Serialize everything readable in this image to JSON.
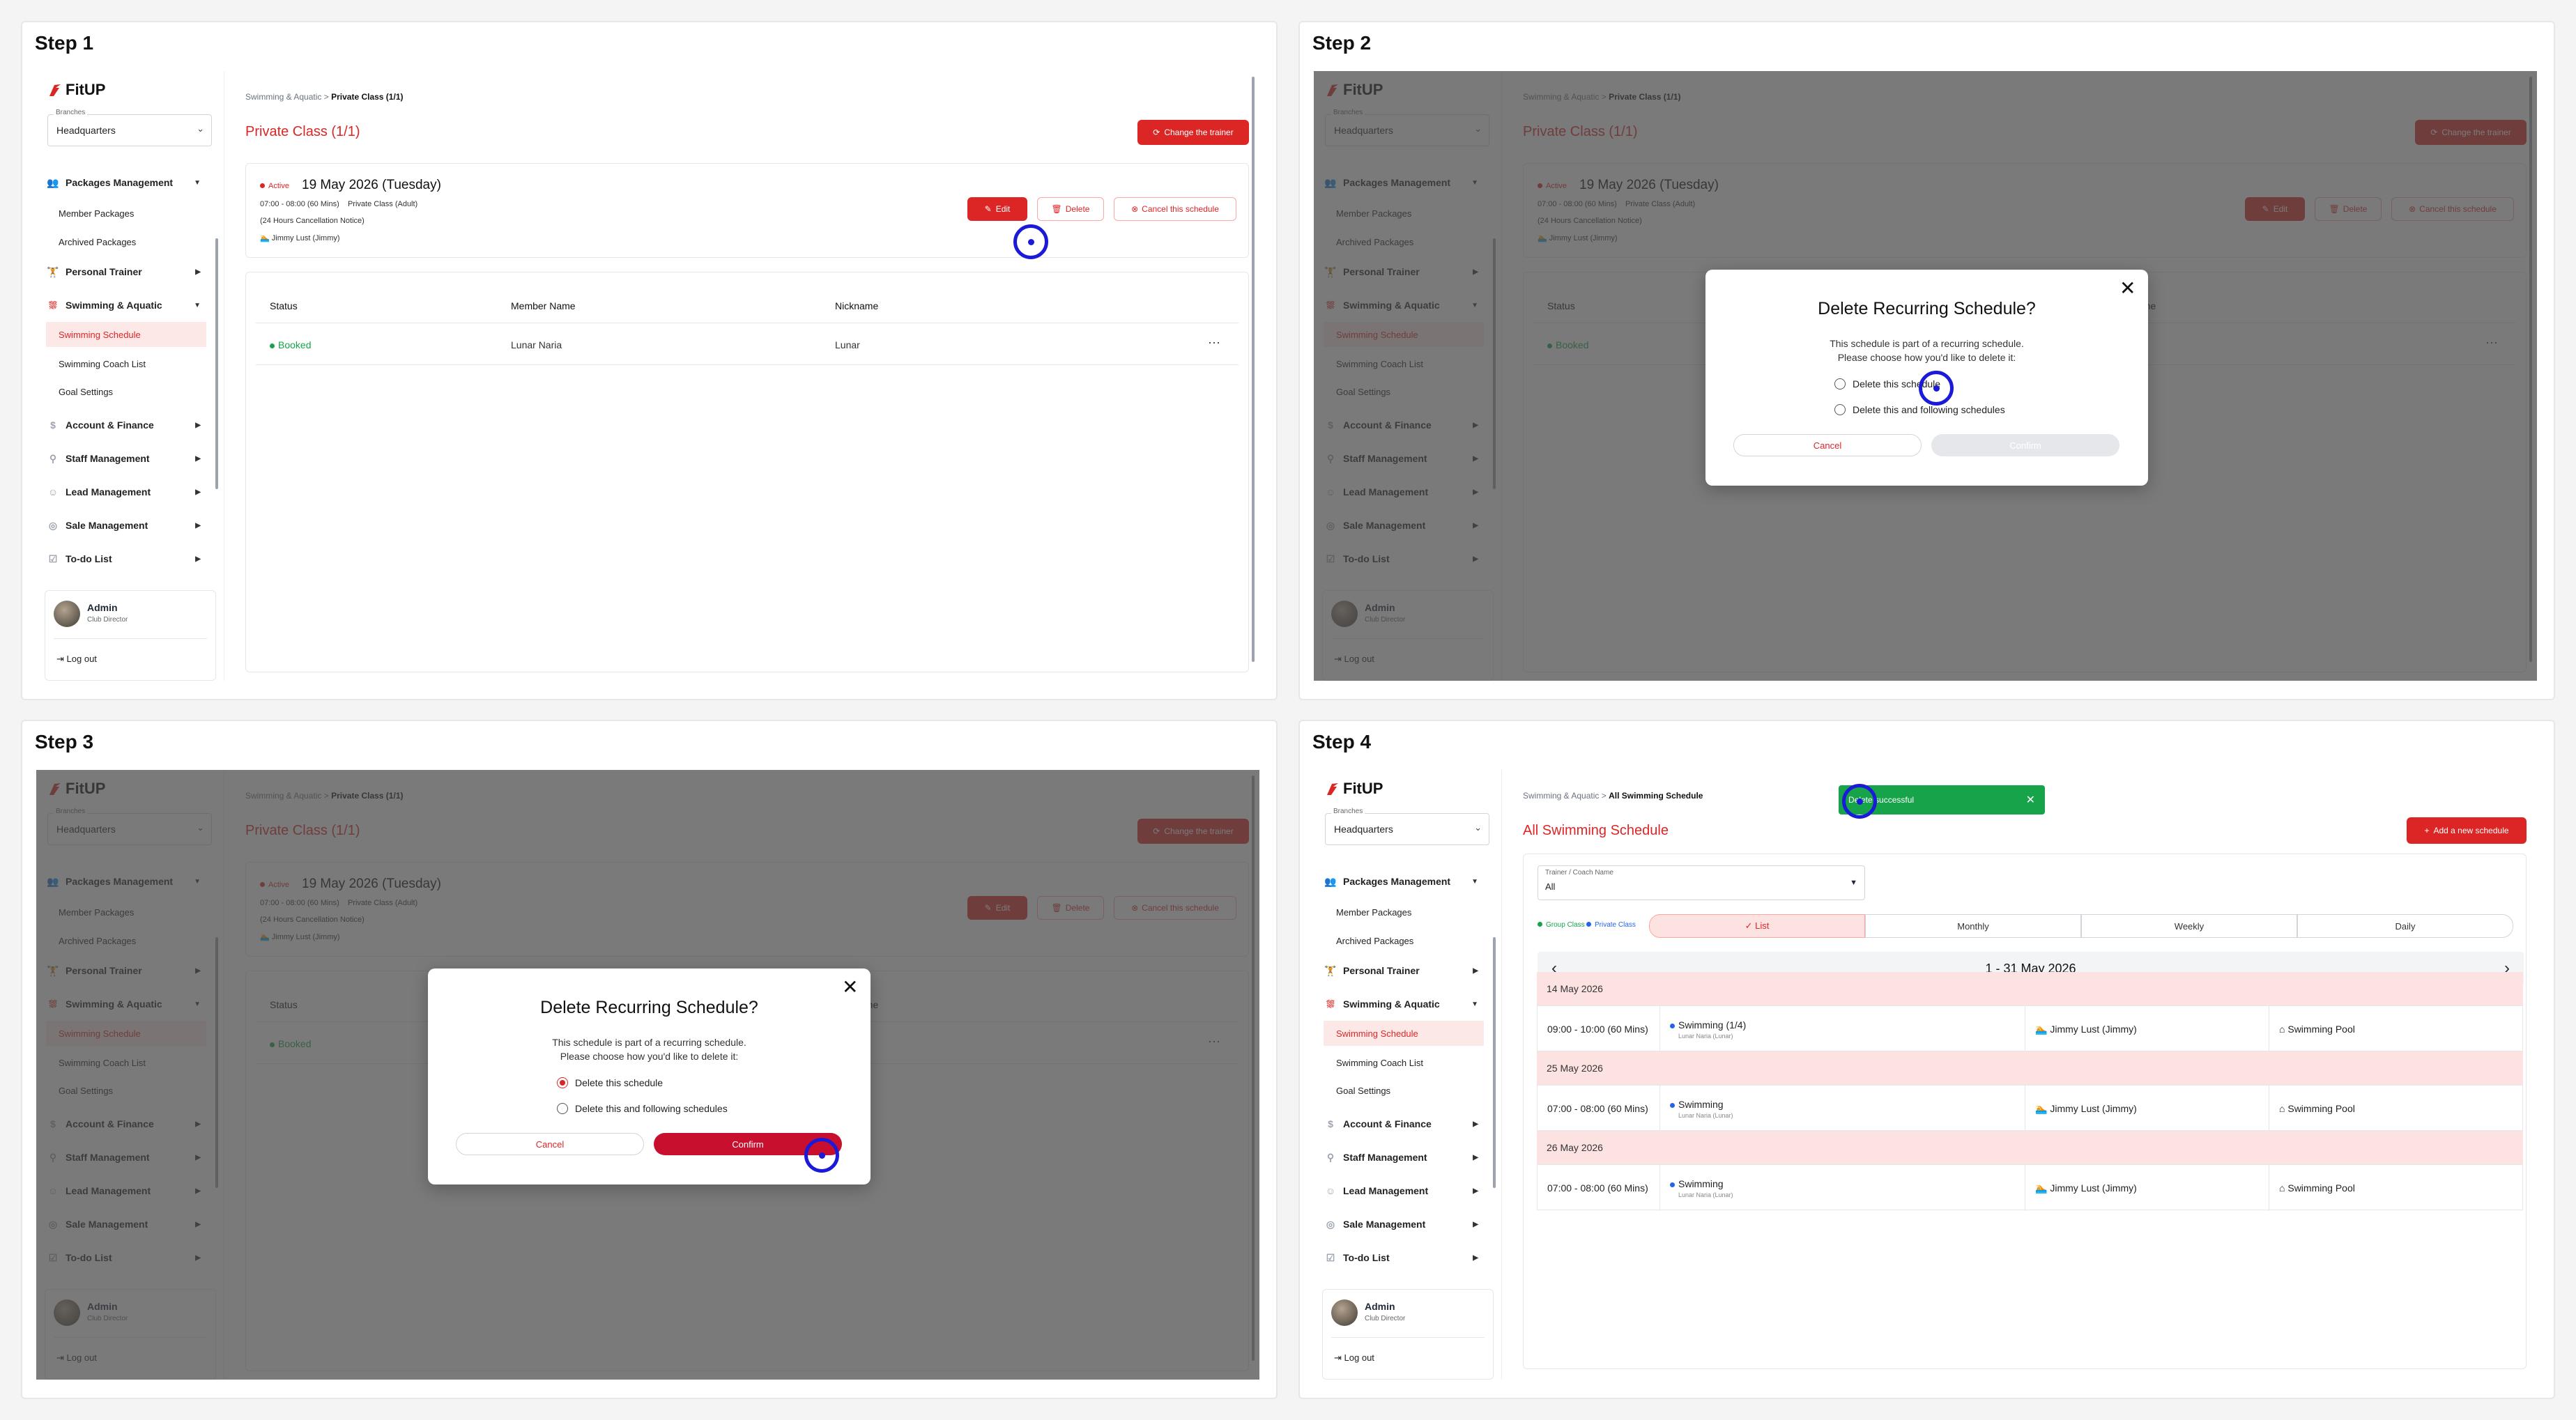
{
  "colors": {
    "brand": "#dc2626",
    "click_marker": "#1a1ad8",
    "success": "#16a34a"
  },
  "steps": [
    "Step 1",
    "Step 2",
    "Step 3",
    "Step 4"
  ],
  "app": {
    "logo": "FitUP",
    "branches_caption": "Branches",
    "branch": "Headquarters"
  },
  "menu": {
    "packages": "Packages Management",
    "member_packages": "Member Packages",
    "archived_packages": "Archived Packages",
    "personal_trainer": "Personal Trainer",
    "swimming": "Swimming & Aquatic",
    "swimming_schedule": "Swimming Schedule",
    "coach_list": "Swimming Coach List",
    "goal_settings": "Goal Settings",
    "account": "Account & Finance",
    "staff": "Staff Management",
    "lead": "Lead Management",
    "sale": "Sale Management",
    "todo": "To-do List"
  },
  "user": {
    "name": "Admin",
    "role": "Club Director",
    "logout": "Log out"
  },
  "detail": {
    "crumb_parent": "Swimming & Aquatic",
    "crumb_sep": ">",
    "crumb_current": "Private Class (1/1)",
    "title": "Private Class (1/1)",
    "change_trainer": "Change the trainer",
    "status": "Active",
    "date": "19 May 2026 (Tuesday)",
    "time": "07:00 - 08:00 (60 Mins)",
    "class_type": "Private Class (Adult)",
    "notice": "(24 Hours Cancellation Notice)",
    "coach": "Jimmy Lust (Jimmy)",
    "edit": "Edit",
    "delete": "Delete",
    "cancel_schedule": "Cancel this schedule",
    "table_headers": [
      "Status",
      "Member Name",
      "Nickname"
    ],
    "row": {
      "status": "Booked",
      "member": "Lunar Naria",
      "nickname": "Lunar",
      "more": "···"
    }
  },
  "modal": {
    "title": "Delete Recurring Schedule?",
    "desc1": "This schedule is part of a recurring schedule.",
    "desc2": "Please choose how you'd like to delete it:",
    "opt1": "Delete this schedule",
    "opt2": "Delete this and following schedules",
    "cancel": "Cancel",
    "confirm": "Confirm",
    "close": "✕"
  },
  "list": {
    "crumb_parent": "Swimming & Aquatic",
    "crumb_current": "All Swimming Schedule",
    "title": "All Swimming Schedule",
    "add": "Add a new schedule",
    "toast": "Delete successful",
    "toast_close": "✕",
    "filter_caption": "Trainer / Coach Name",
    "filter_value": "All",
    "legend_group": "Group Class",
    "legend_private": "Private Class",
    "tabs": [
      "✓ List",
      "Monthly",
      "Weekly",
      "Daily"
    ],
    "range": "1 - 31 May 2026",
    "prev": "‹",
    "next": "›",
    "days": [
      {
        "date": "14 May 2026",
        "time": "09:00 - 10:00 (60 Mins)",
        "name": "Swimming (1/4)",
        "member": "Lunar Naria (Lunar)",
        "coach": "Jimmy Lust (Jimmy)",
        "place": "Swimming Pool"
      },
      {
        "date": "25 May 2026",
        "time": "07:00 - 08:00 (60 Mins)",
        "name": "Swimming",
        "member": "Lunar Naria (Lunar)",
        "coach": "Jimmy Lust (Jimmy)",
        "place": "Swimming Pool"
      },
      {
        "date": "26 May 2026",
        "time": "07:00 - 08:00 (60 Mins)",
        "name": "Swimming",
        "member": "Lunar Naria (Lunar)",
        "coach": "Jimmy Lust (Jimmy)",
        "place": "Swimming Pool"
      }
    ]
  }
}
